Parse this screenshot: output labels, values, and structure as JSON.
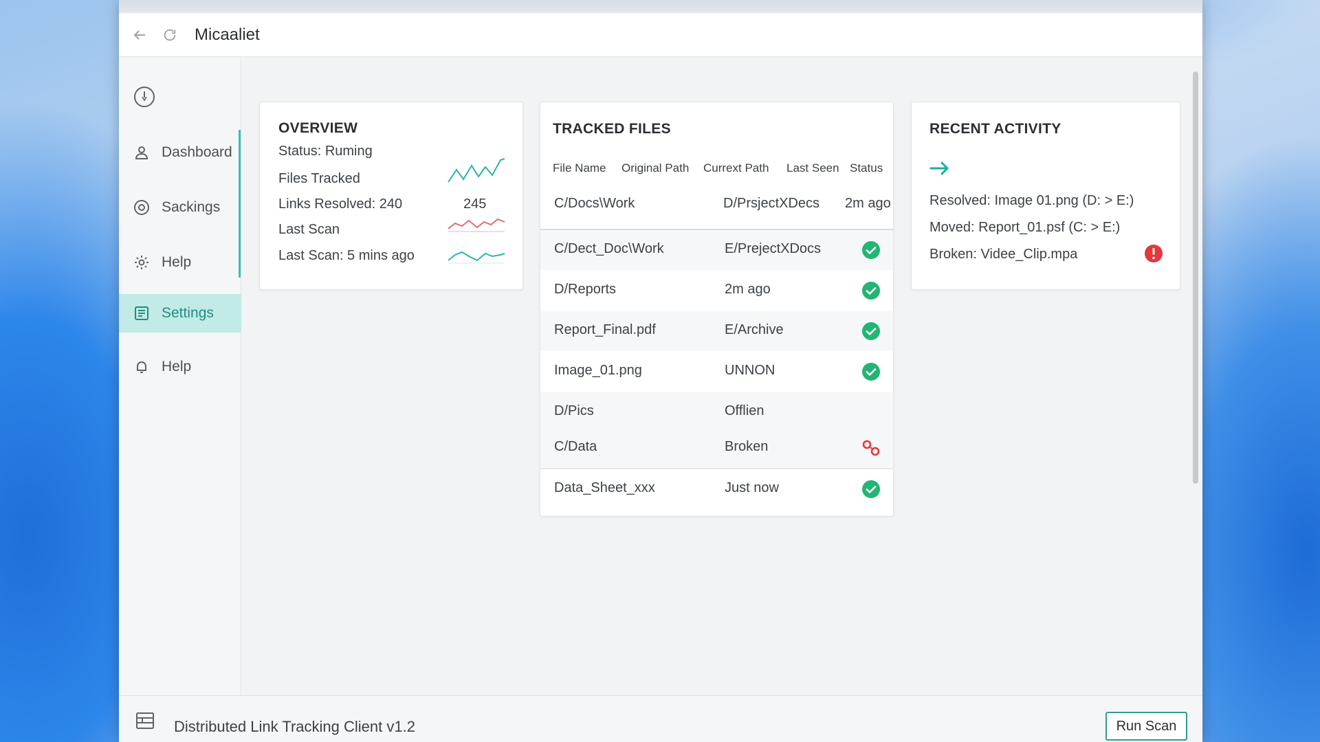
{
  "window": {
    "title": "Micaaliet"
  },
  "sidebar": {
    "items": [
      {
        "label": "Dashboard",
        "icon": "user-icon"
      },
      {
        "label": "Sackings",
        "icon": "circle-settings-icon"
      },
      {
        "label": "Help",
        "icon": "gear-icon"
      },
      {
        "label": "Settings",
        "icon": "list-icon",
        "active": true
      },
      {
        "label": "Help",
        "icon": "bell-icon"
      }
    ]
  },
  "overview": {
    "title": "OVERVIEW",
    "status": "Status: Ruming",
    "files_tracked": "Files Tracked",
    "links_resolved": "Links Resolved: 240",
    "links_number": "245",
    "last_scan": "Last Scan",
    "last_scan_time": "Last Scan: 5 mins ago"
  },
  "tracked_files": {
    "title": "TRACKED FILES",
    "columns": [
      "File Name",
      "Original Path",
      "Currext Path",
      "Last Seen",
      "Status"
    ],
    "rows": [
      {
        "c1": "C/Docs\\Work",
        "c2": "D/PrsjectXDecs",
        "c3": "2m ago",
        "status": ""
      },
      {
        "c1": "C/Dect_Doc\\Work",
        "c2": "E/PrejectXDocs",
        "c3": "",
        "status": "ok"
      },
      {
        "c1": "D/Reports",
        "c2": "2m ago",
        "c3": "",
        "status": "ok"
      },
      {
        "c1": "Report_Final.pdf",
        "c2": "E/Archive",
        "c3": "",
        "status": "ok"
      },
      {
        "c1": "Image_01.png",
        "c2": "UNNON",
        "c3": "",
        "status": "ok"
      },
      {
        "c1": "D/Pics",
        "c2": "Offlien",
        "c3": "",
        "status": ""
      },
      {
        "c1": "C/Data",
        "c2": "Broken",
        "c3": "",
        "status": "broken"
      },
      {
        "c1": "Data_Sheet_xxx",
        "c2": "Just now",
        "c3": "",
        "status": "ok"
      }
    ]
  },
  "recent_activity": {
    "title": "RECENT ACTIVITY",
    "items": [
      "Resolved: Image 01.png (D: > E:)",
      "Moved: Report_01.psf (C: > E:)",
      "Broken: Videe_Clip.mpa"
    ]
  },
  "status_bar": {
    "text": "Distributed Link Tracking Client v1.2",
    "run_button": "Run Scan"
  },
  "colors": {
    "accent": "#3dbfb0",
    "success": "#22b573",
    "error": "#e0393e"
  }
}
